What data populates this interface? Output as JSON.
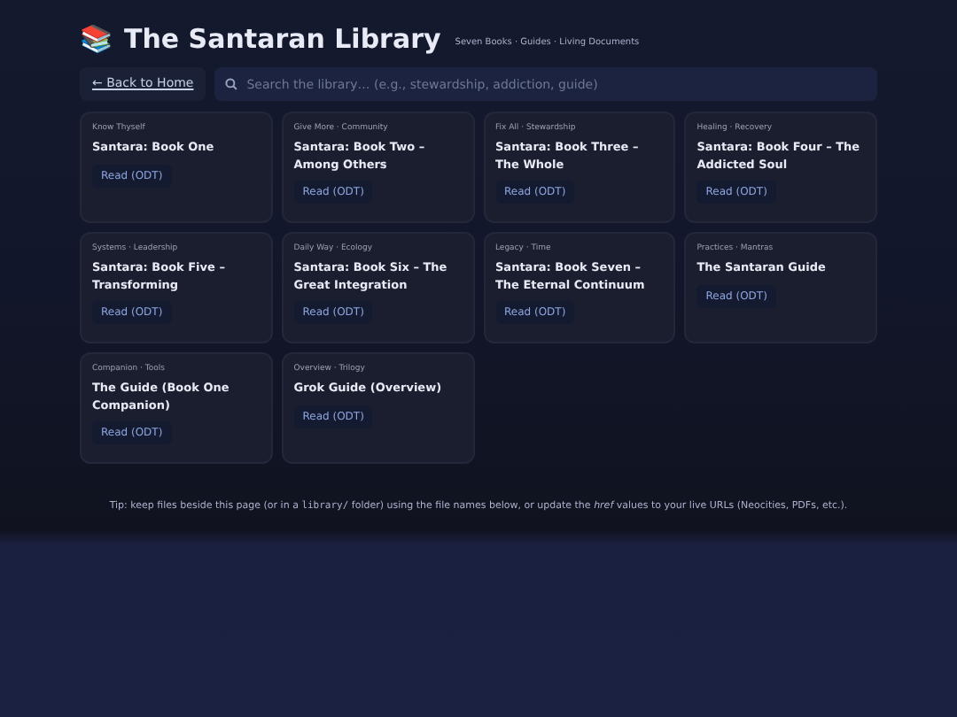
{
  "header": {
    "icon": "📚",
    "title": "The Santaran Library",
    "subtitle": "Seven Books · Guides · Living Documents"
  },
  "back_link": "← Back to Home",
  "search": {
    "placeholder": "Search the library… (e.g., stewardship, addiction, guide)"
  },
  "cards": [
    {
      "tags": "Know Thyself",
      "title": "Santara: Book One",
      "button": "Read (ODT)"
    },
    {
      "tags": "Give More · Community",
      "title": "Santara: Book Two – Among Others",
      "button": "Read (ODT)"
    },
    {
      "tags": "Fix All · Stewardship",
      "title": "Santara: Book Three – The Whole",
      "button": "Read (ODT)"
    },
    {
      "tags": "Healing · Recovery",
      "title": "Santara: Book Four – The Addicted Soul",
      "button": "Read (ODT)"
    },
    {
      "tags": "Systems · Leadership",
      "title": "Santara: Book Five – Transforming",
      "button": "Read (ODT)"
    },
    {
      "tags": "Daily Way · Ecology",
      "title": "Santara: Book Six – The Great Integration",
      "button": "Read (ODT)"
    },
    {
      "tags": "Legacy · Time",
      "title": "Santara: Book Seven – The Eternal Continuum",
      "button": "Read (ODT)"
    },
    {
      "tags": "Practices · Mantras",
      "title": "The Santaran Guide",
      "button": "Read (ODT)"
    },
    {
      "tags": "Companion · Tools",
      "title": "The Guide (Book One Companion)",
      "button": "Read (ODT)"
    },
    {
      "tags": "Overview · Trilogy",
      "title": "Grok Guide (Overview)",
      "button": "Read (ODT)"
    }
  ],
  "tip": {
    "before": "Tip: keep files beside this page (or in a ",
    "code": "library/",
    "after": " folder) using the file names below, or update the *href* values to your live URLs (Neocities, PDFs, etc.)."
  }
}
